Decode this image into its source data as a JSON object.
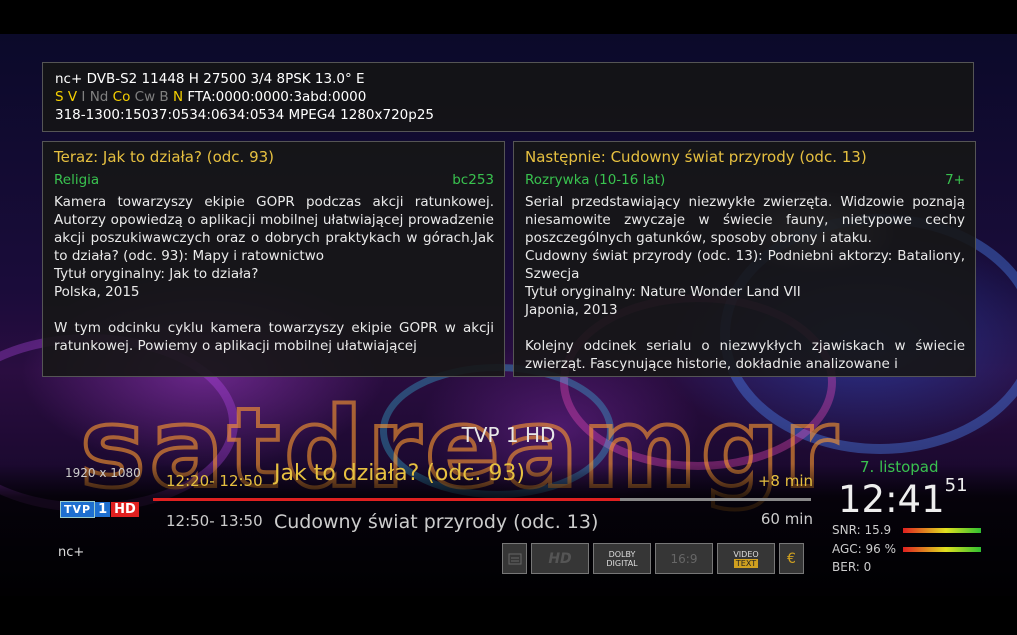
{
  "signal_info": {
    "line1": "nc+ DVB-S2 11448 H 27500 3/4 8PSK 13.0° E",
    "flags": [
      {
        "text": "S",
        "active": true
      },
      {
        "text": "V",
        "active": true
      },
      {
        "text": "I",
        "active": false
      },
      {
        "text": "Nd",
        "active": false
      },
      {
        "text": "Co",
        "active": true
      },
      {
        "text": "Cw",
        "active": false
      },
      {
        "text": "B",
        "active": false
      },
      {
        "text": "N",
        "active": true
      }
    ],
    "fta": "FTA:0000:0000:3abd:0000",
    "line3": "318-1300:15037:0534:0634:0534 MPEG4 1280x720p25"
  },
  "now_panel": {
    "title": "Teraz: Jak to działa? (odc. 93)",
    "genre": "Religia",
    "rating": "bc253",
    "description": "Kamera towarzyszy ekipie GOPR podczas akcji ratunkowej. Autorzy opowiedzą o aplikacji mobilnej ułatwiającej prowadzenie akcji poszukiwawczych oraz o dobrych praktykach w górach.Jak to działa? (odc. 93): Mapy i ratownictwo\nTytuł oryginalny: Jak to działa?\nPolska, 2015\n\nW tym odcinku cyklu kamera towarzyszy ekipie GOPR w akcji ratunkowej. Powiemy o aplikacji mobilnej ułatwiającej"
  },
  "next_panel": {
    "title": "Następnie: Cudowny świat przyrody (odc. 13)",
    "genre": "Rozrywka (10-16 lat)",
    "rating": "7+",
    "description": "Serial przedstawiający niezwykłe zwierzęta. Widzowie poznają niesamowite zwyczaje w świecie fauny, nietypowe cechy poszczególnych gatunków, sposoby obrony i ataku.\nCudowny świat przyrody (odc. 13): Podniebni aktorzy: Bataliony, Szwecja\nTytuł oryginalny: Nature Wonder Land VII\nJaponia, 2013\n\nKolejny odcinek serialu o niezwykłych zjawiskach w świecie zwierząt. Fascynujące historie, dokładnie analizowane i"
  },
  "channel": {
    "name": "TVP 1 HD",
    "resolution": "1920 x 1080",
    "logo": {
      "box": "TVP",
      "num": "1",
      "hd": "HD"
    },
    "provider": "nc+"
  },
  "current_event": {
    "time": "12:20- 12:50",
    "title": "Jak to działa? (odc. 93)",
    "remaining": "+8 min",
    "progress": 0.71
  },
  "next_event": {
    "time": "12:50- 13:50",
    "title": "Cudowny świat przyrody (odc. 13)",
    "duration": "60 min"
  },
  "clock": {
    "date": "7. listopad",
    "time": "12:41",
    "seconds": "51"
  },
  "signal": {
    "snr_label": "SNR:",
    "snr": "15.9",
    "agc_label": "AGC:",
    "agc": "96 %",
    "ber_label": "BER:",
    "ber": "0"
  },
  "badges": {
    "hd": "HD",
    "dolby_1": "DOLBY",
    "dolby_2": "DIGITAL",
    "aspect": "16:9",
    "video": "VIDEO",
    "text": "TEXT",
    "crypt": "€"
  },
  "colors": {
    "accent_yellow": "#e6c040",
    "accent_green": "#39c24f",
    "progress_red": "#e02020"
  }
}
